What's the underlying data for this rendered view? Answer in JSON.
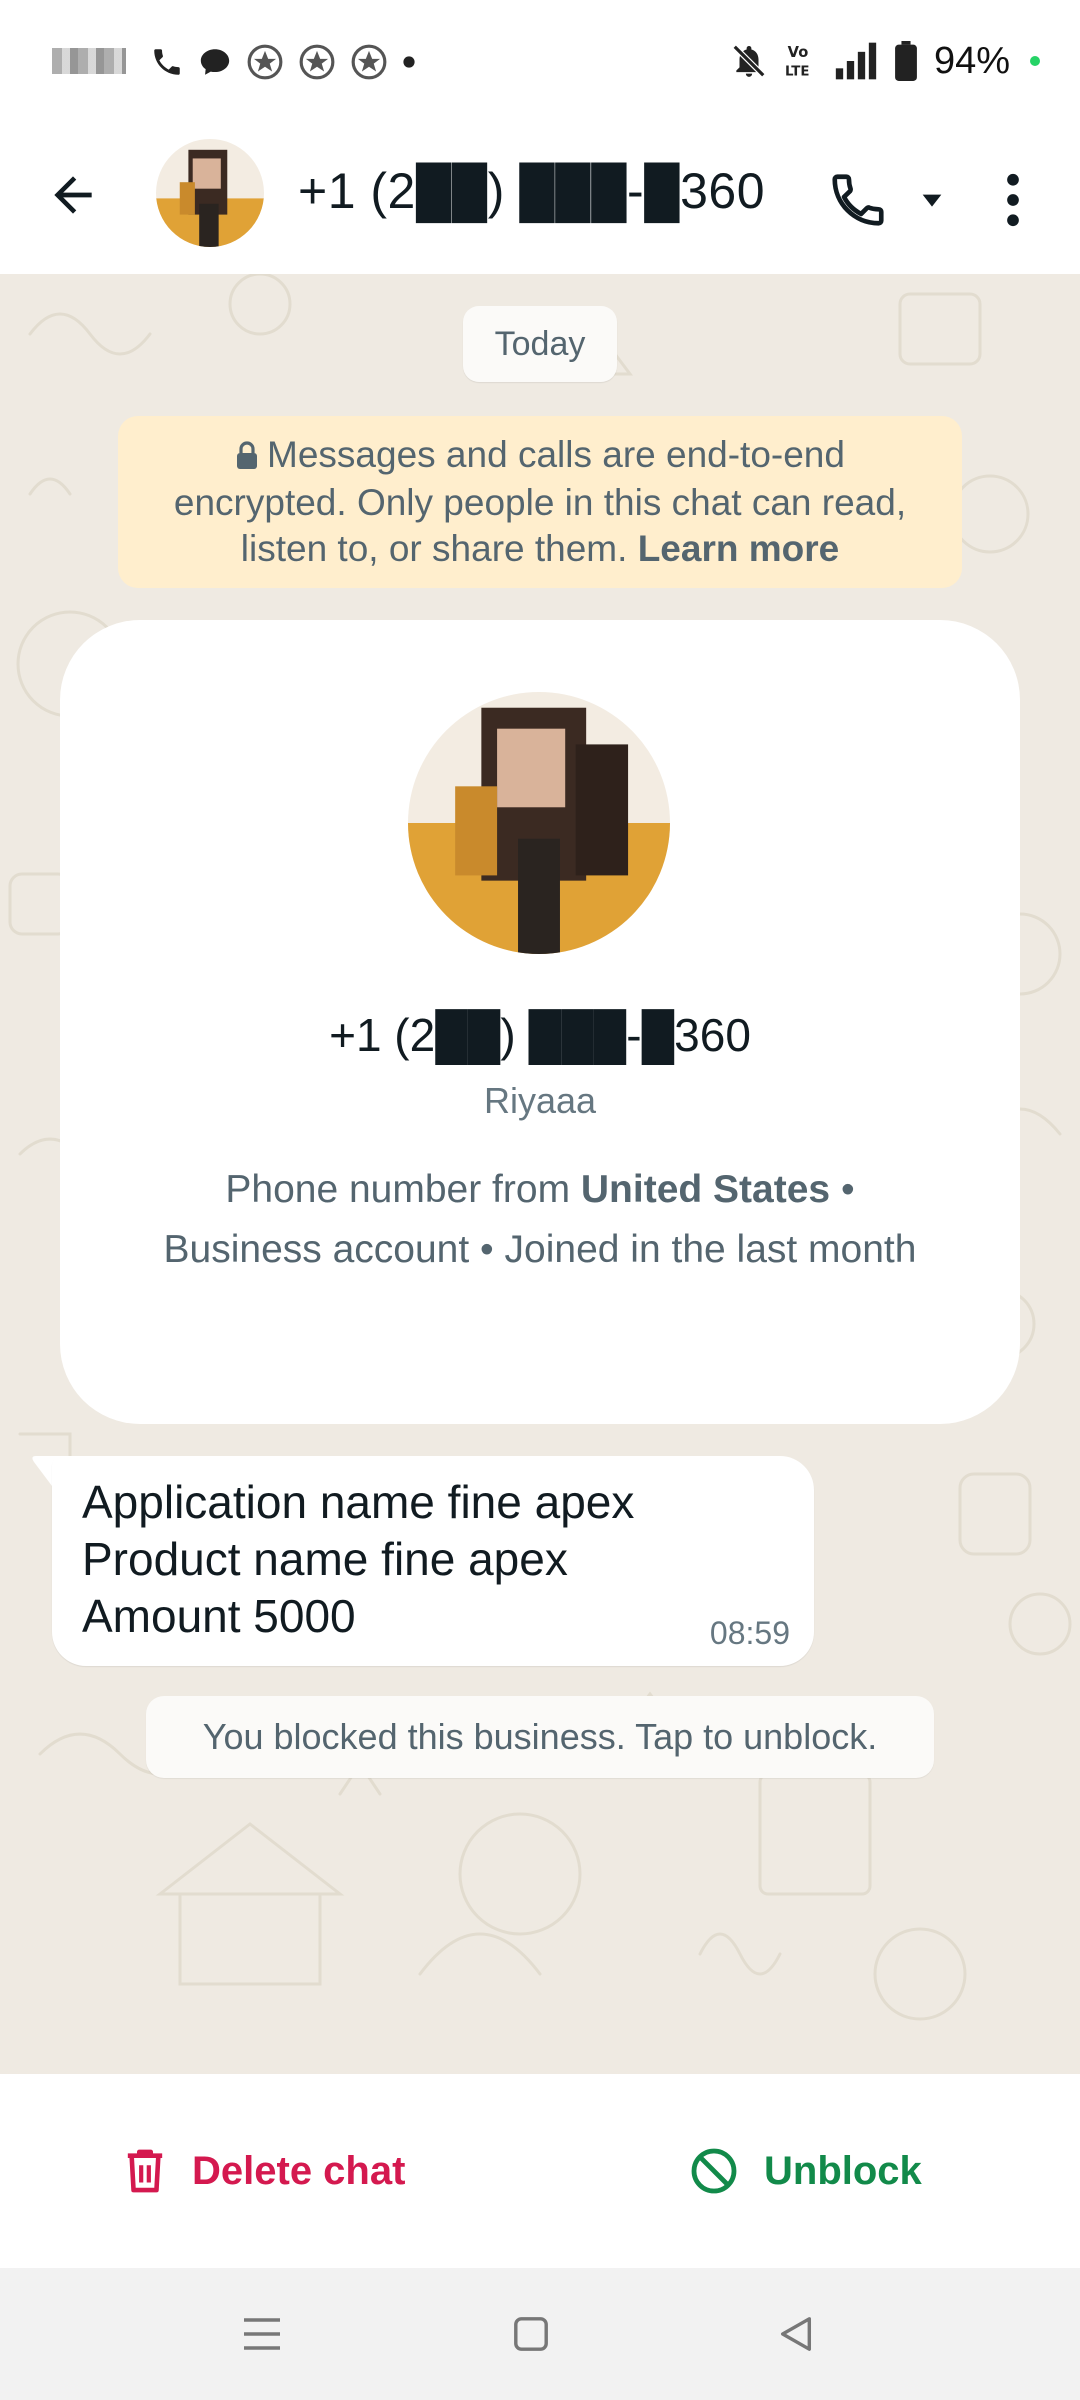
{
  "header": {
    "title": "+1 (2██) ███-█360",
    "back_icon": "arrow-left-icon",
    "call_icon": "phone-icon",
    "more_icon": "more-vert-icon"
  },
  "status_bar": {
    "battery": "94%"
  },
  "chat": {
    "date_chip": "Today",
    "encryption_notice": {
      "text": "Messages and calls are end-to-end encrypted. Only people in this chat can read, listen to, or share them.",
      "link": "Learn more"
    },
    "profile": {
      "phone": "+1 (2██) ███-█360",
      "name": "Riyaaa",
      "info_prefix": "Phone number from ",
      "country": "United States",
      "info_suffix": " • Business account • Joined in the last month"
    },
    "messages": [
      {
        "lines": [
          "Application name fine apex",
          "Product name fine apex",
          "Amount 5000"
        ],
        "time": "08:59"
      }
    ],
    "blocked_notice": "You blocked this business. Tap to unblock."
  },
  "actions": {
    "delete_label": "Delete chat",
    "unblock_label": "Unblock"
  },
  "colors": {
    "chat_bg": "#efeae2",
    "delete": "#d4194f",
    "unblock": "#128a4a",
    "notice_bg": "#ffeecd"
  }
}
